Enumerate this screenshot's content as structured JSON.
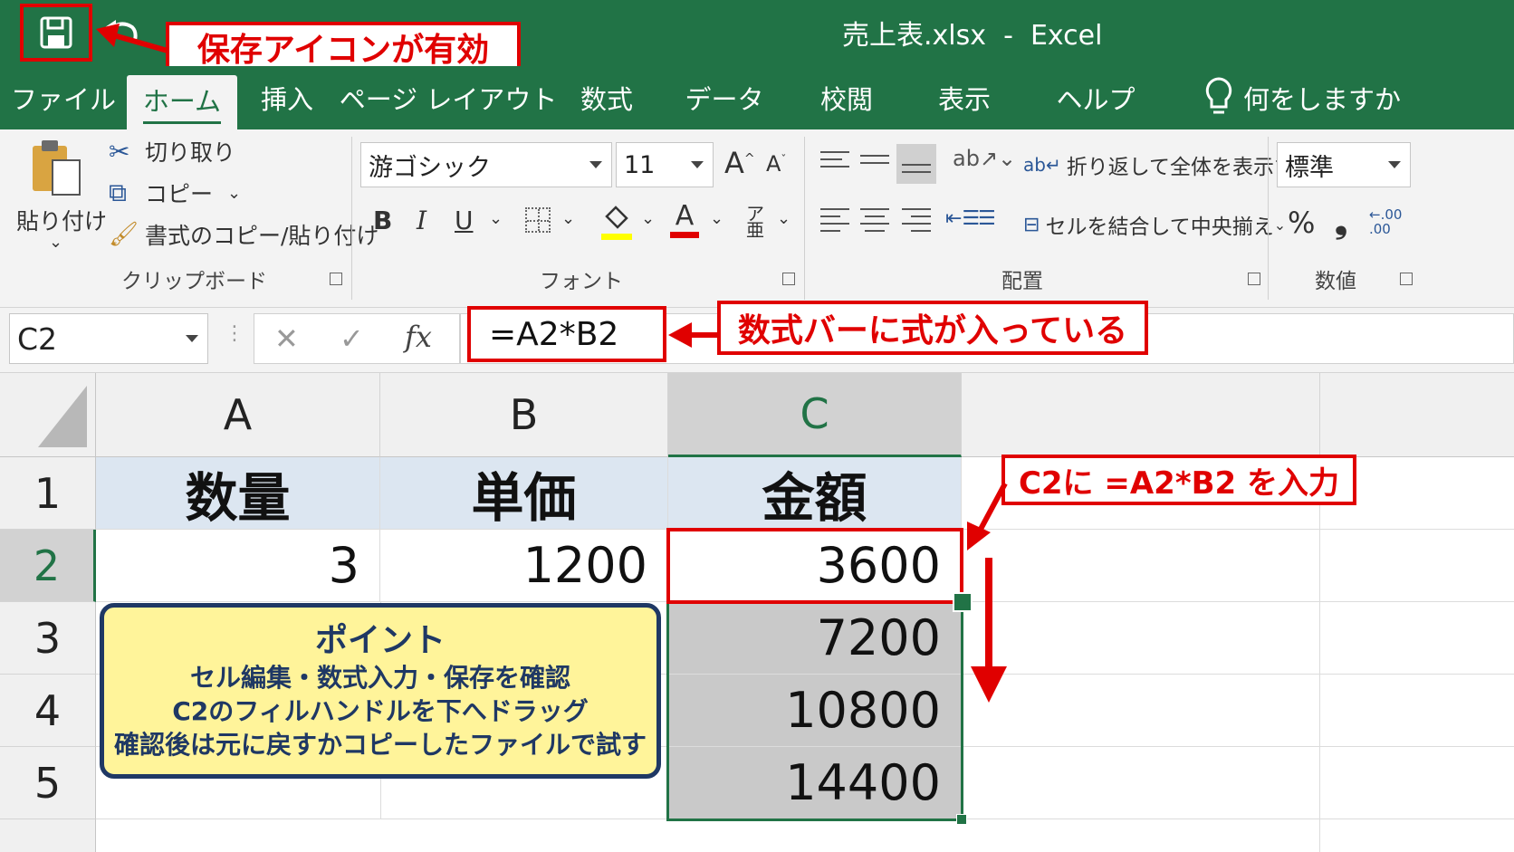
{
  "window": {
    "title": "売上表.xlsx  -  Excel"
  },
  "annotations": {
    "save": "保存アイコンが有効",
    "formula": "数式バーに式が入っている",
    "cell": "C2に =A2*B2 を入力"
  },
  "tabs": [
    "ファイル",
    "ホーム",
    "挿入",
    "ページ レイアウト",
    "数式",
    "データ",
    "校閲",
    "表示",
    "ヘルプ"
  ],
  "tell_me": "何をしますか",
  "ribbon": {
    "clipboard": {
      "paste": "貼り付け",
      "cut": "切り取り",
      "copy": "コピー",
      "format_painter": "書式のコピー/貼り付け",
      "label": "クリップボード"
    },
    "font": {
      "name": "游ゴシック",
      "size": "11",
      "grow": "A",
      "shrink": "A",
      "bold": "B",
      "italic": "I",
      "underline": "U",
      "font_color": "A",
      "label": "フォント"
    },
    "alignment": {
      "wrap": "折り返して全体を表示する",
      "merge": "セルを結合して中央揃え",
      "label": "配置"
    },
    "number": {
      "format": "標準",
      "percent": "%",
      "comma": "❟",
      "label": "数値"
    }
  },
  "formula_bar": {
    "name_box": "C2",
    "fx": "fx",
    "formula": "=A2*B2"
  },
  "grid": {
    "columns": [
      "A",
      "B",
      "C"
    ],
    "rows": [
      "1",
      "2",
      "3",
      "4",
      "5"
    ],
    "headers": [
      "数量",
      "単価",
      "金額"
    ],
    "a2": "3",
    "b2": "1200",
    "c_values": [
      "3600",
      "7200",
      "10800",
      "14400"
    ]
  },
  "point": {
    "title": "ポイント",
    "lines": [
      "セル編集・数式入力・保存を確認",
      "C2のフィルハンドルを下へドラッグ",
      "確認後は元に戻すかコピーしたファイルで試す"
    ]
  },
  "colors": {
    "excel_green": "#217346",
    "annotation_red": "#e00000",
    "point_bg": "#fff49a",
    "point_border": "#1f3864",
    "header_blue": "#dce6f1"
  }
}
